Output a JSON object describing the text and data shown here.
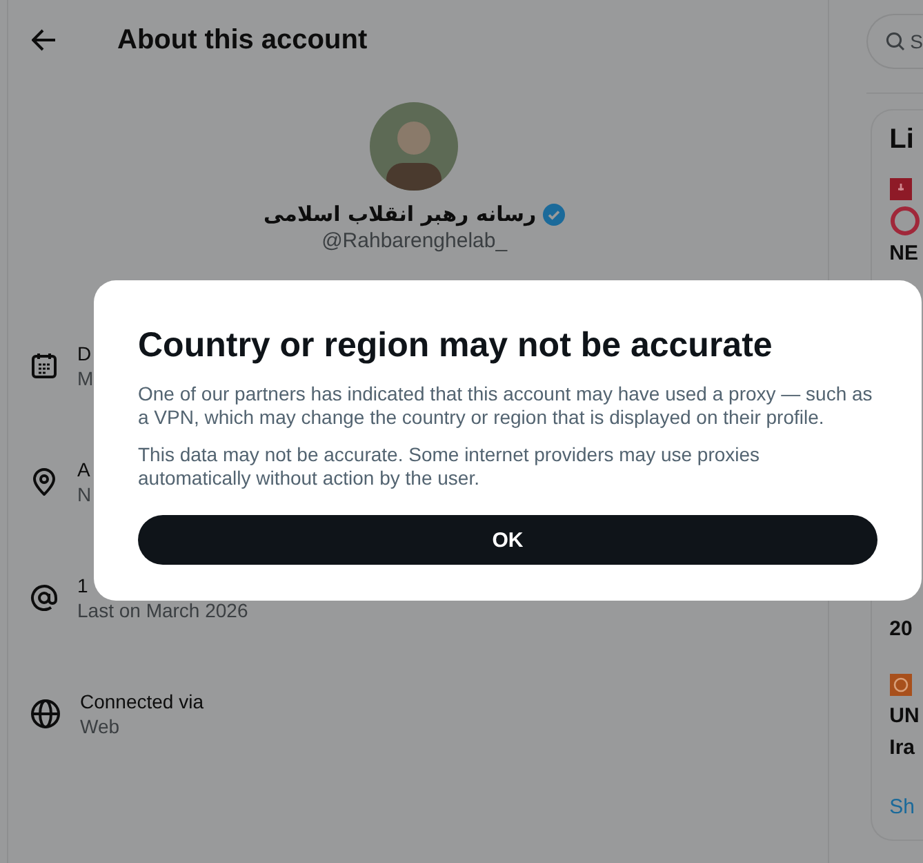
{
  "header": {
    "title": "About this account"
  },
  "profile": {
    "name": "رسانه رهبر انقلاب اسلامی",
    "verified": true,
    "handle": "@Rahbarenghelab_"
  },
  "details": [
    {
      "kind": "calendar",
      "label": "D",
      "value": "M"
    },
    {
      "kind": "location",
      "label": "A",
      "value": "N"
    },
    {
      "kind": "at",
      "label": "1",
      "value": "Last on March 2026"
    },
    {
      "kind": "globe",
      "label": "Connected via",
      "value": "Web"
    }
  ],
  "sidebar": {
    "search": {
      "placeholder": "S"
    },
    "heading": "Li",
    "items": [
      {
        "kind": "live",
        "lines": [
          "NE"
        ]
      },
      {
        "kind": "plain",
        "lines": [
          "20"
        ]
      },
      {
        "kind": "channel",
        "lines": [
          "UN",
          "Ira"
        ]
      }
    ],
    "link": "Sh"
  },
  "dialog": {
    "title": "Country or region may not be accurate",
    "paragraphs": [
      "One of our partners has indicated that this account may have used a proxy — such as a VPN, which may change the country or region that is displayed on their profile.",
      "This data may not be accurate. Some internet providers may use proxies automatically without action by the user."
    ],
    "button": "OK"
  }
}
